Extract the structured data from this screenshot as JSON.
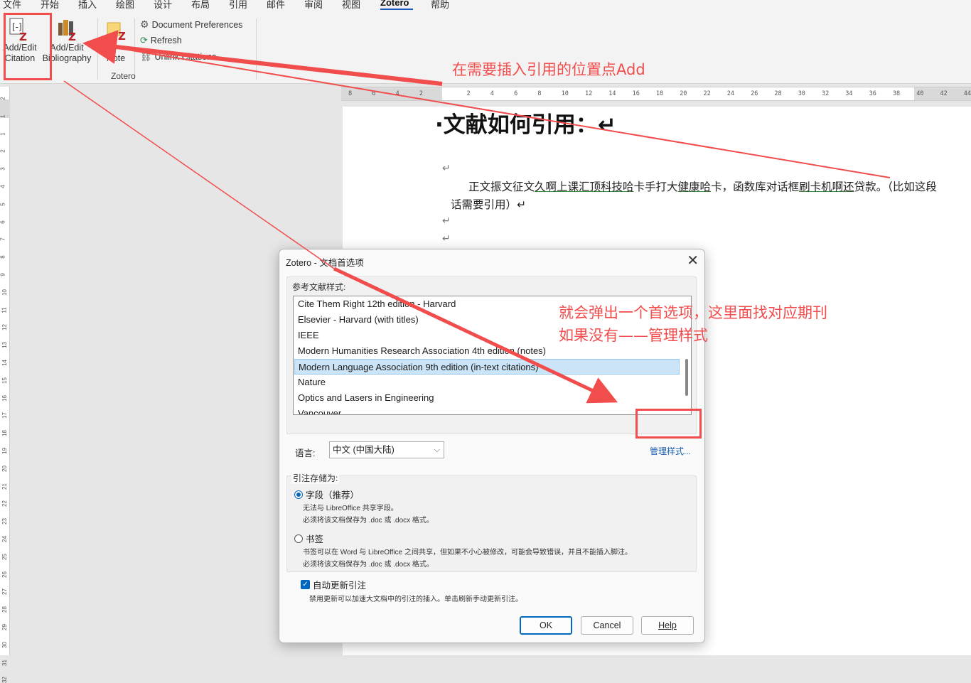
{
  "menu": {
    "tabs": [
      "文件",
      "开始",
      "插入",
      "绘图",
      "设计",
      "布局",
      "引用",
      "邮件",
      "审阅",
      "视图",
      "Zotero",
      "帮助"
    ],
    "active_tab": "Zotero"
  },
  "ribbon": {
    "add_edit_citation": "Add/Edit\nCitation",
    "add_edit_bibliography": "Add/Edit\nBibliography",
    "add_note": "Note",
    "document_preferences": "Document Preferences",
    "refresh": "Refresh",
    "unlink_citations": "Unlink Citations",
    "group_label": "Zotero"
  },
  "ruler": {
    "corner": "L",
    "h_ticks": [
      "8",
      "6",
      "4",
      "2",
      "",
      "2",
      "4",
      "6",
      "8",
      "10",
      "12",
      "14",
      "16",
      "18",
      "20",
      "22",
      "24",
      "26",
      "28",
      "30",
      "32",
      "34",
      "36",
      "38",
      "40",
      "42",
      "44"
    ],
    "v_ticks": [
      "2",
      "1",
      "1",
      "2",
      "3",
      "4",
      "5",
      "6",
      "7",
      "8",
      "9",
      "10",
      "11",
      "12",
      "13",
      "14",
      "15",
      "16",
      "17",
      "18",
      "19",
      "20",
      "21",
      "22",
      "23",
      "24",
      "25",
      "26",
      "27",
      "28",
      "29",
      "30",
      "31",
      "32"
    ]
  },
  "document": {
    "heading": "·文献如何引用：↵",
    "paragraph_parts": [
      {
        "text": "正文振文征文",
        "cite": false
      },
      {
        "text": "久啊上课汇顶科技哈",
        "cite": true
      },
      {
        "text": "卡手打大",
        "cite": false
      },
      {
        "text": "健康哈",
        "cite": true
      },
      {
        "text": "卡，函数库对话框",
        "cite": false
      },
      {
        "text": "刷卡机啊还",
        "cite": true
      },
      {
        "text": "贷款。（比如这段话需要引用）↵",
        "cite": false
      }
    ],
    "para_mark": "↵"
  },
  "dialog": {
    "title": "Zotero - 文档首选项",
    "close": "✕",
    "style_label": "参考文献样式:",
    "styles": [
      "Cite Them Right 12th edition - Harvard",
      "Elsevier - Harvard (with titles)",
      "IEEE",
      "Modern Humanities Research Association 4th edition (notes)",
      "Modern Language Association 9th edition (in-text citations)",
      "Nature",
      "Optics and Lasers in Engineering",
      "Vancouver"
    ],
    "selected_style": "Modern Language Association 9th edition (in-text citations)",
    "manage_styles": "管理样式...",
    "language_label": "语言:",
    "language_value": "中文 (中国大陆)",
    "store_label": "引注存储为:",
    "field_option": "字段（推荐）",
    "field_hint_1": "无法与 LibreOffice 共享字段。",
    "field_hint_2": "必须将该文档保存为 .doc 或 .docx 格式。",
    "bookmark_option": "书签",
    "bookmark_hint_1": "书签可以在 Word 与 LibreOffice 之间共享，但如果不小心被修改，可能会导致错误，并且不能插入脚注。",
    "bookmark_hint_2": "必须将该文档保存为 .doc 或 .docx 格式。",
    "auto_update": "自动更新引注",
    "auto_update_hint": "禁用更新可以加速大文档中的引注的插入。单击刷新手动更新引注。",
    "ok": "OK",
    "cancel": "Cancel",
    "help": "Help"
  },
  "annotations": {
    "note_1": "在需要插入引用的位置点Add",
    "note_2_line1": "就会弹出一个首选项，这里面找对应期刊",
    "note_2_line2": "如果没有——管理样式",
    "color": "#f24d4d"
  }
}
